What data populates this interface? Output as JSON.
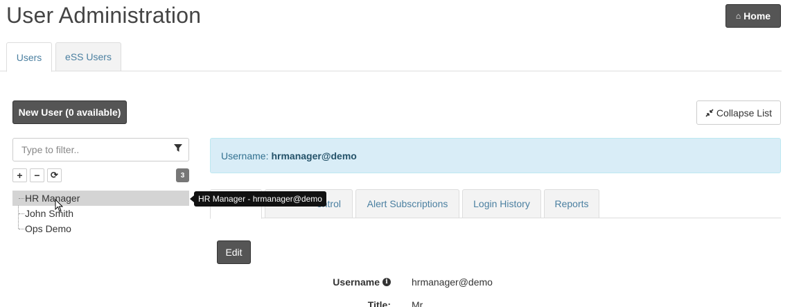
{
  "page": {
    "title": "User Administration"
  },
  "header": {
    "home_label": "Home",
    "home_icon": "home-icon"
  },
  "main_tabs": [
    {
      "label": "Users",
      "active": true
    },
    {
      "label": "eSS Users",
      "active": false
    }
  ],
  "toolbar": {
    "new_user_label": "New User (0 available)",
    "collapse_label": "Collapse List",
    "collapse_icon": "compress-icon"
  },
  "filter": {
    "placeholder": "Type to filter..",
    "icon": "filter-icon"
  },
  "tree_controls": {
    "expand": "+",
    "collapse": "−",
    "refresh": "⟳",
    "count": "3"
  },
  "tree": {
    "items": [
      {
        "label": "HR Manager",
        "selected": true
      },
      {
        "label": "John Smith",
        "selected": false
      },
      {
        "label": "Ops Demo",
        "selected": false
      }
    ]
  },
  "tooltip": {
    "text": "HR Manager - hrmanager@demo"
  },
  "alert": {
    "label": "Username:",
    "value": "hrmanager@demo"
  },
  "sub_tabs": [
    {
      "label": "",
      "active": true
    },
    {
      "label": "Access Control",
      "visible_fragment": "ontrol",
      "active": false
    },
    {
      "label": "Alert Subscriptions",
      "active": false
    },
    {
      "label": "Login History",
      "active": false
    },
    {
      "label": "Reports",
      "active": false
    }
  ],
  "details": {
    "edit_label": "Edit",
    "username_label": "Username",
    "username_value": "hrmanager@demo",
    "title_label": "Title:",
    "title_value": "Mr"
  },
  "colors": {
    "dark_button": "#555555",
    "tab_link": "#4a7fa0",
    "alert_bg": "#d9edf7",
    "selected_row": "#d4d4d4"
  }
}
